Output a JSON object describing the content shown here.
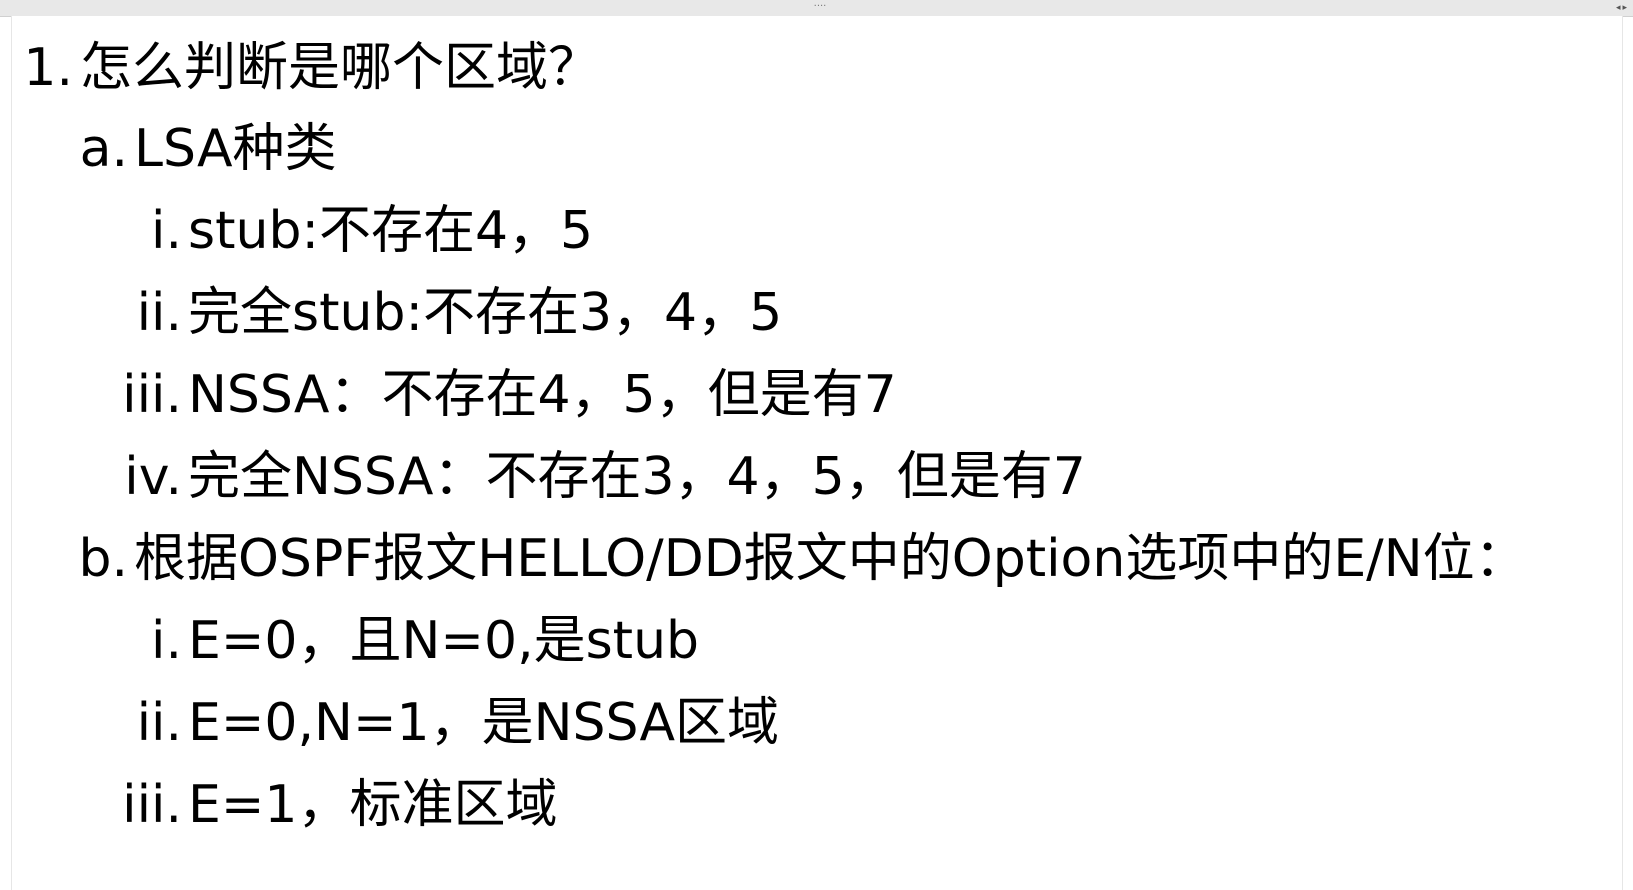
{
  "window": {
    "drag_handle": "····",
    "left_arrow": "◂",
    "right_arrow": "▸"
  },
  "outline": [
    {
      "marker": "1.",
      "text": "怎么判断是哪个区域？"
    },
    {
      "marker": "a.",
      "text": "LSA种类"
    },
    {
      "marker": "i.",
      "text": "stub:不存在4，5"
    },
    {
      "marker": "ii.",
      "text": "完全stub:不存在3，4，5"
    },
    {
      "marker": "iii.",
      "text": "NSSA：不存在4，5，但是有7"
    },
    {
      "marker": "iv.",
      "text": "完全NSSA：不存在3，4，5，但是有7"
    },
    {
      "marker": "b.",
      "text": "根据OSPF报文HELLO/DD报文中的Option选项中的E/N位："
    },
    {
      "marker": "i.",
      "text": "E=0，且N=0,是stub"
    },
    {
      "marker": "ii.",
      "text": "E=0,N=1，是NSSA区域"
    },
    {
      "marker": "iii.",
      "text": "E=1，标准区域"
    }
  ]
}
